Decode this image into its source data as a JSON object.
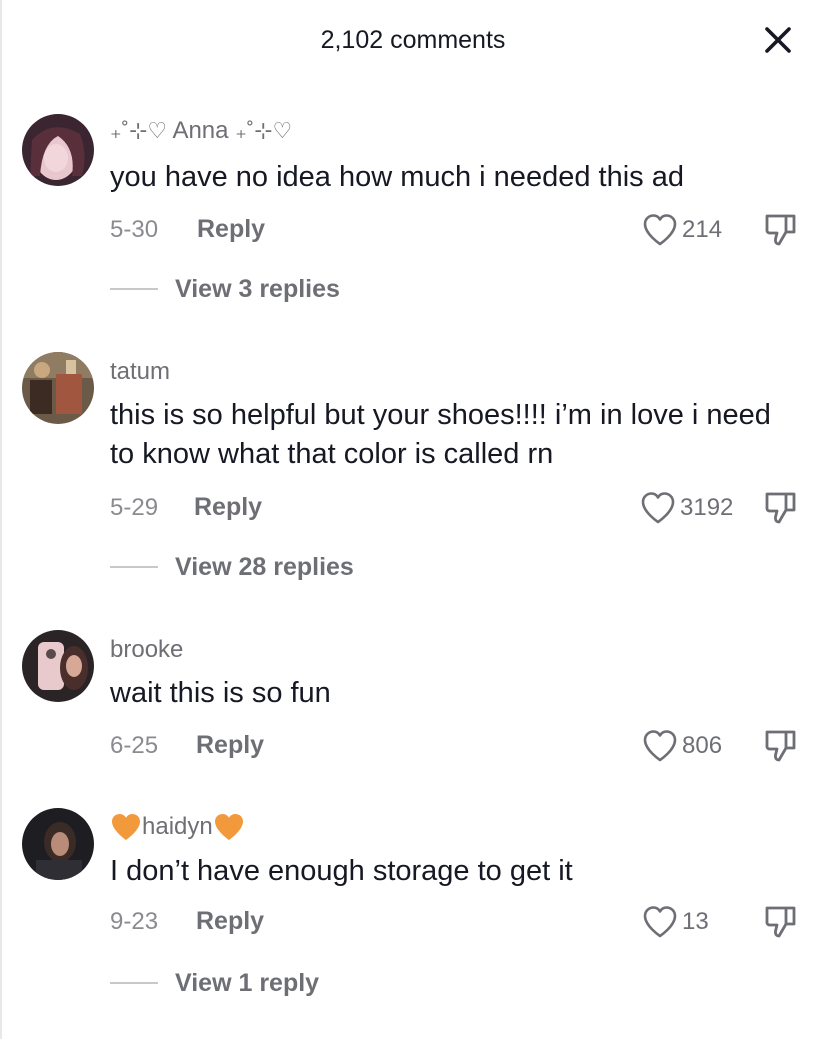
{
  "header": {
    "title": "2,102 comments",
    "close_icon": "close-icon"
  },
  "comments": [
    {
      "username_prefix": "₊˚⊹♡",
      "username": "Anna",
      "username_suffix": "₊˚⊹♡",
      "text": "you have no idea how much i needed this ad",
      "date": "5-30",
      "reply_label": "Reply",
      "likes": "214",
      "view_replies": "View 3 replies"
    },
    {
      "username": "tatum",
      "text": "this is so helpful but your shoes!!!! i’m in love i need to know what that color is called rn",
      "date": "5-29",
      "reply_label": "Reply",
      "likes": "3192",
      "view_replies": "View 28 replies"
    },
    {
      "username": "brooke",
      "text": "wait this is so fun",
      "date": "6-25",
      "reply_label": "Reply",
      "likes": "806"
    },
    {
      "username": "haidyn",
      "text": "I don’t have enough storage to get it",
      "date": "9-23",
      "reply_label": "Reply",
      "likes": "13",
      "view_replies": "View 1 reply"
    }
  ],
  "icons": {
    "heart": "heart-outline-icon",
    "dislike": "thumbs-down-icon",
    "close": "close-icon",
    "orange_heart": "orange-heart-emoji"
  },
  "colors": {
    "text": "#161823",
    "muted": "#6e6f75",
    "orange_heart": "#F29A3B"
  }
}
